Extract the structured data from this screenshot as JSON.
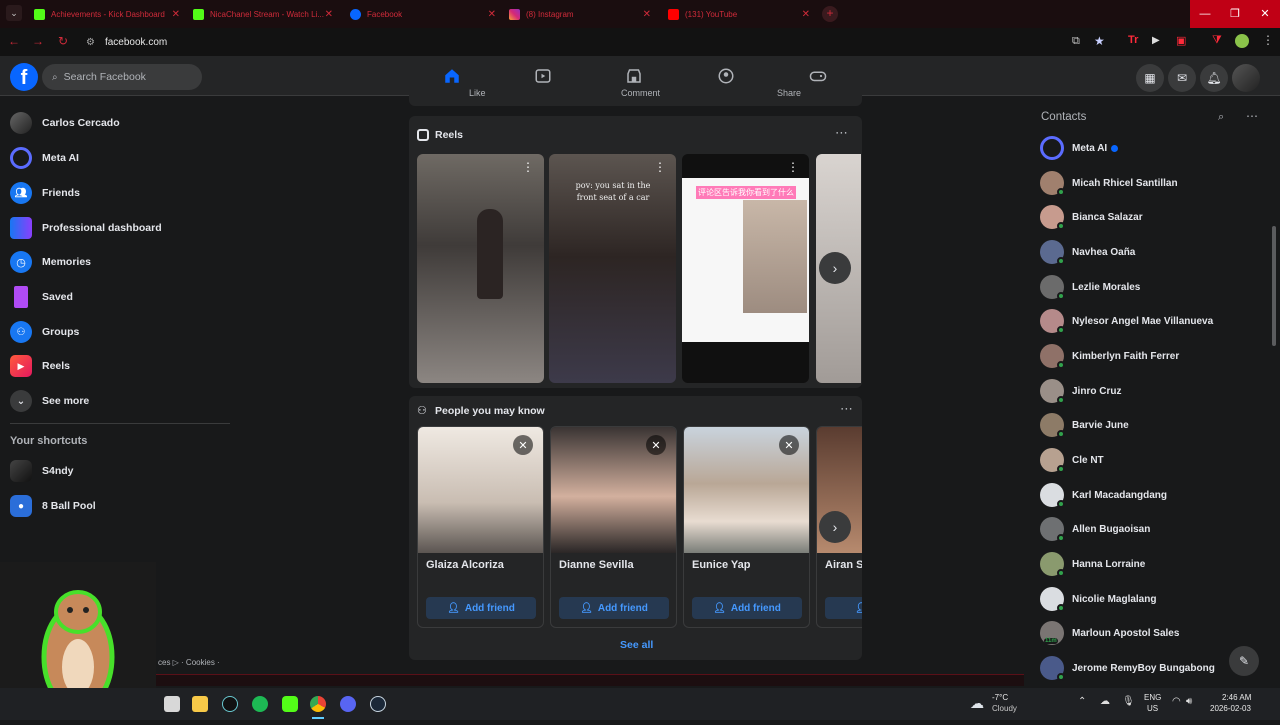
{
  "browser": {
    "tabs": [
      {
        "title": "Achievements - Kick Dashboard",
        "icon": "kick-icon"
      },
      {
        "title": "NicaChanel Stream - Watch Li...",
        "icon": "kick-icon"
      },
      {
        "title": "Facebook",
        "icon": "facebook-icon"
      },
      {
        "title": "(8) Instagram",
        "icon": "instagram-icon"
      },
      {
        "title": "(131) YouTube",
        "icon": "youtube-icon"
      }
    ],
    "url": "facebook.com"
  },
  "header": {
    "search_placeholder": "Search Facebook"
  },
  "left_nav": {
    "items": [
      {
        "label": "Carlos Cercado",
        "icon": "profile-avatar"
      },
      {
        "label": "Meta AI",
        "icon": "meta-ai-icon"
      },
      {
        "label": "Friends",
        "icon": "friends-icon"
      },
      {
        "label": "Professional dashboard",
        "icon": "dashboard-icon"
      },
      {
        "label": "Memories",
        "icon": "memories-icon"
      },
      {
        "label": "Saved",
        "icon": "saved-icon"
      },
      {
        "label": "Groups",
        "icon": "groups-icon"
      },
      {
        "label": "Reels",
        "icon": "reels-icon"
      },
      {
        "label": "See more",
        "icon": "chevron-down-icon"
      }
    ],
    "shortcuts_title": "Your shortcuts",
    "shortcuts": [
      {
        "label": "S4ndy"
      },
      {
        "label": "8 Ball Pool"
      }
    ]
  },
  "feed": {
    "post_actions": [
      "Like",
      "Comment",
      "Share"
    ],
    "reels": {
      "title": "Reels",
      "items": [
        {
          "caption": ""
        },
        {
          "caption": "pov: you sat in the front seat of a car"
        },
        {
          "caption": "评论区告诉我你看到了什么"
        },
        {
          "caption": ""
        }
      ]
    },
    "pymk": {
      "title": "People you may know",
      "people": [
        {
          "name": "Glaiza Alcoriza",
          "action": "Add friend"
        },
        {
          "name": "Dianne Sevilla",
          "action": "Add friend"
        },
        {
          "name": "Eunice Yap",
          "action": "Add friend"
        },
        {
          "name": "Airan S",
          "action": "Add friend"
        }
      ],
      "see_all": "See all"
    }
  },
  "footer_text": "ces ▷ · Cookies ·",
  "contacts": {
    "title": "Contacts",
    "items": [
      {
        "name": "Meta AI",
        "verified": true
      },
      {
        "name": "Micah Rhicel Santillan"
      },
      {
        "name": "Bianca Salazar"
      },
      {
        "name": "Navhea Oaña"
      },
      {
        "name": "Lezlie Morales"
      },
      {
        "name": "Nylesor Angel Mae Villanueva"
      },
      {
        "name": "Kimberlyn Faith Ferrer"
      },
      {
        "name": "Jinro Cruz"
      },
      {
        "name": "Barvie June"
      },
      {
        "name": "Cle NT"
      },
      {
        "name": "Karl Macadangdang"
      },
      {
        "name": "Allen Bugaoisan"
      },
      {
        "name": "Hanna Lorraine"
      },
      {
        "name": "Nicolie Maglalang"
      },
      {
        "name": "Marloun Apostol Sales",
        "badge": "11m"
      },
      {
        "name": "Jerome RemyBoy Bungabong"
      }
    ]
  },
  "taskbar": {
    "weather_temp": "-7°C",
    "weather_text": "Cloudy",
    "lang": "ENG",
    "region": "US",
    "time": "2:46 AM",
    "date": "2026-02-03"
  },
  "colors": {
    "accent": "#0866ff",
    "bg": "#18191a",
    "card": "#242526",
    "browser_red": "#c00015"
  }
}
